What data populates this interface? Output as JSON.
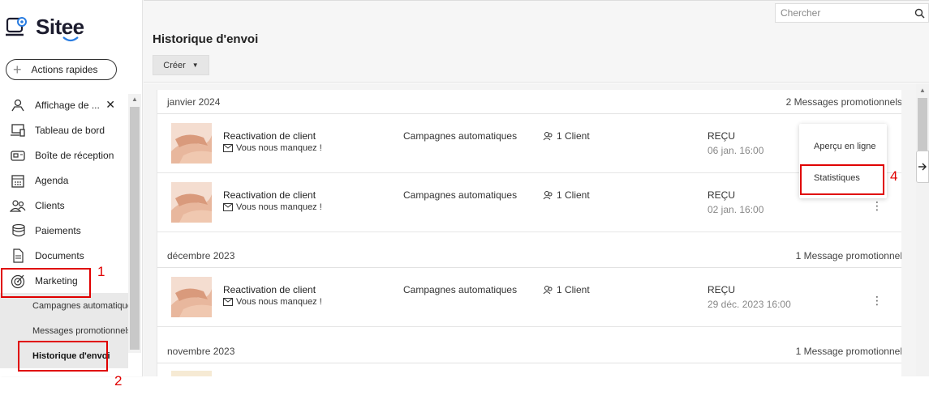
{
  "app": {
    "name": "Sitee"
  },
  "sidebar": {
    "quick_actions": "Actions rapides",
    "items": [
      {
        "label": "Affichage de ...",
        "icon": "contacts-display-icon"
      },
      {
        "label": "Tableau de bord",
        "icon": "dashboard-icon"
      },
      {
        "label": "Boîte de réception",
        "icon": "inbox-icon"
      },
      {
        "label": "Agenda",
        "icon": "calendar-icon"
      },
      {
        "label": "Clients",
        "icon": "users-icon"
      },
      {
        "label": "Paiements",
        "icon": "coins-icon"
      },
      {
        "label": "Documents",
        "icon": "document-icon"
      },
      {
        "label": "Marketing",
        "icon": "target-icon"
      }
    ],
    "subitems": [
      {
        "label": "Campagnes automatiques"
      },
      {
        "label": "Messages promotionnels"
      },
      {
        "label": "Historique d'envoi"
      }
    ]
  },
  "search": {
    "placeholder": "Chercher"
  },
  "page": {
    "title": "Historique d'envoi",
    "create_label": "Créer"
  },
  "groups": [
    {
      "month": "janvier 2024",
      "count": "2  Messages promotionnels",
      "rows": [
        {
          "title": "Reactivation de client",
          "subject": "Vous nous manquez !",
          "type": "Campagnes automatiques",
          "clients": "1 Client",
          "status": "REÇU",
          "date": "06 jan. 16:00"
        },
        {
          "title": "Reactivation de client",
          "subject": "Vous nous manquez !",
          "type": "Campagnes automatiques",
          "clients": "1 Client",
          "status": "REÇU",
          "date": "02 jan. 16:00"
        }
      ]
    },
    {
      "month": "décembre 2023",
      "count": "1  Message promotionnel",
      "rows": [
        {
          "title": "Reactivation de client",
          "subject": "Vous nous manquez !",
          "type": "Campagnes automatiques",
          "clients": "1 Client",
          "status": "REÇU",
          "date": "29 déc. 2023 16:00"
        }
      ]
    },
    {
      "month": "novembre 2023",
      "count": "1  Message promotionnel",
      "rows": []
    }
  ],
  "dropdown": {
    "items": [
      "Aperçu en ligne",
      "Statistiques"
    ]
  },
  "annotations": [
    "1",
    "2",
    "4"
  ],
  "colors": {
    "accent": "#2a7de1",
    "annotation": "#e00000"
  }
}
